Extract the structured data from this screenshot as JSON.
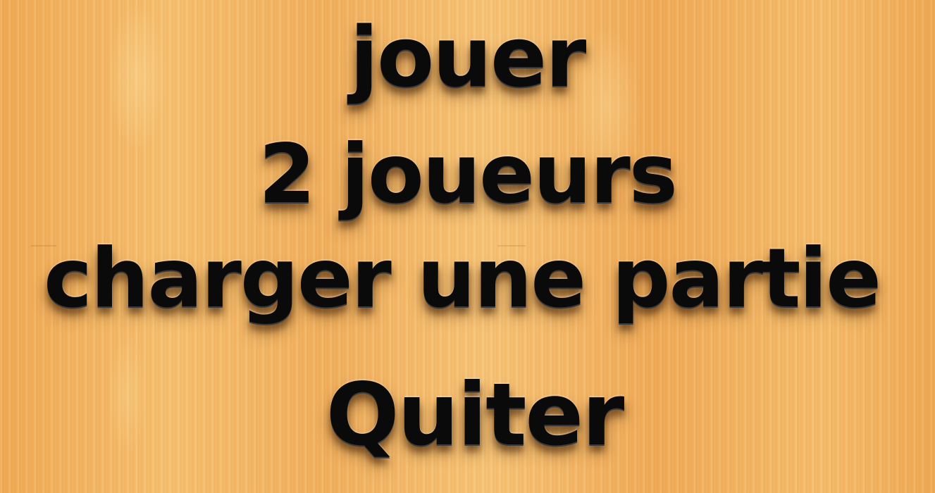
{
  "menu": {
    "items": [
      {
        "label": "jouer"
      },
      {
        "label": "2 joueurs"
      },
      {
        "label": "charger une partie"
      },
      {
        "label": "Quiter"
      }
    ]
  },
  "colors": {
    "background": "#f2b35c",
    "text": "#0a0a0a"
  }
}
